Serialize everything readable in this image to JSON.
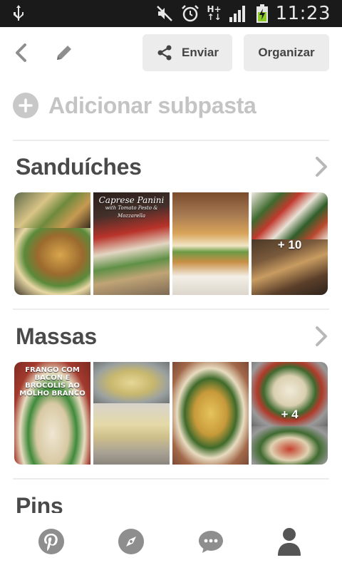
{
  "status_bar": {
    "time": "11:23",
    "network_top": "H+",
    "network_bottom": "↑↓",
    "icons": [
      "usb-icon",
      "mute-icon",
      "alarm-icon",
      "signal-icon",
      "battery-charging-icon"
    ]
  },
  "toolbar": {
    "back_icon": "back-arrow-icon",
    "edit_icon": "pencil-icon",
    "send_label": "Enviar",
    "organize_label": "Organizar"
  },
  "add_subfolder": {
    "label": "Adicionar subpasta"
  },
  "sections": [
    {
      "title": "Sanduíches",
      "more_count": "+ 10",
      "tiles": [
        {
          "caption": ""
        },
        {
          "caption": "Caprese Panini",
          "subcaption": "with Tomato Pesto & Mozzarella"
        },
        {
          "caption": ""
        },
        {
          "caption": ""
        }
      ]
    },
    {
      "title": "Massas",
      "more_count": "+ 4",
      "tiles": [
        {
          "caption": "FRANGO COM BACON E BROCOLIS AO MOLHO BRANCO"
        },
        {
          "caption": ""
        },
        {
          "caption": ""
        },
        {
          "caption": ""
        }
      ]
    },
    {
      "title": "Pins"
    }
  ],
  "bottom_nav": {
    "items": [
      "pinterest-home-icon",
      "compass-explore-icon",
      "chat-bubble-icon",
      "profile-icon"
    ],
    "active_index": 3
  },
  "colors": {
    "status_bar_bg": "#1a1a1a",
    "button_bg": "#ececec",
    "muted_text": "#c4c4c4",
    "title_text": "#4a4a4a",
    "icon_gray": "#8e8e8e",
    "active_icon": "#555555"
  }
}
